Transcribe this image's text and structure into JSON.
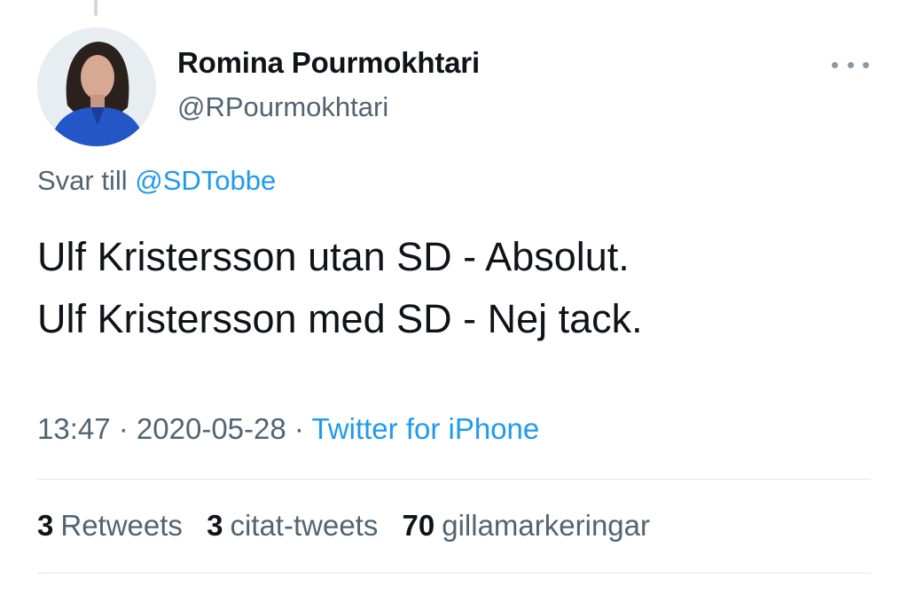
{
  "author": {
    "name": "Romina Pourmokhtari",
    "handle": "@RPourmokhtari"
  },
  "reply": {
    "prefix": "Svar till",
    "mention": "@SDTobbe"
  },
  "tweet": {
    "line1": "Ulf Kristersson utan SD - Absolut.",
    "line2": "Ulf Kristersson med SD - Nej tack."
  },
  "meta": {
    "time": "13:47",
    "separator1": " · ",
    "date": "2020-05-28",
    "separator2": " · ",
    "source": "Twitter for iPhone"
  },
  "stats": {
    "retweets_count": "3",
    "retweets_label": "Retweets",
    "quotes_count": "3",
    "quotes_label": "citat-tweets",
    "likes_count": "70",
    "likes_label": "gillamarkeringar"
  },
  "icons": {
    "more": "more-horizontal-icon"
  },
  "colors": {
    "link": "#1d9bf0",
    "secondary_text": "#536471",
    "primary_text": "#0f1419"
  }
}
